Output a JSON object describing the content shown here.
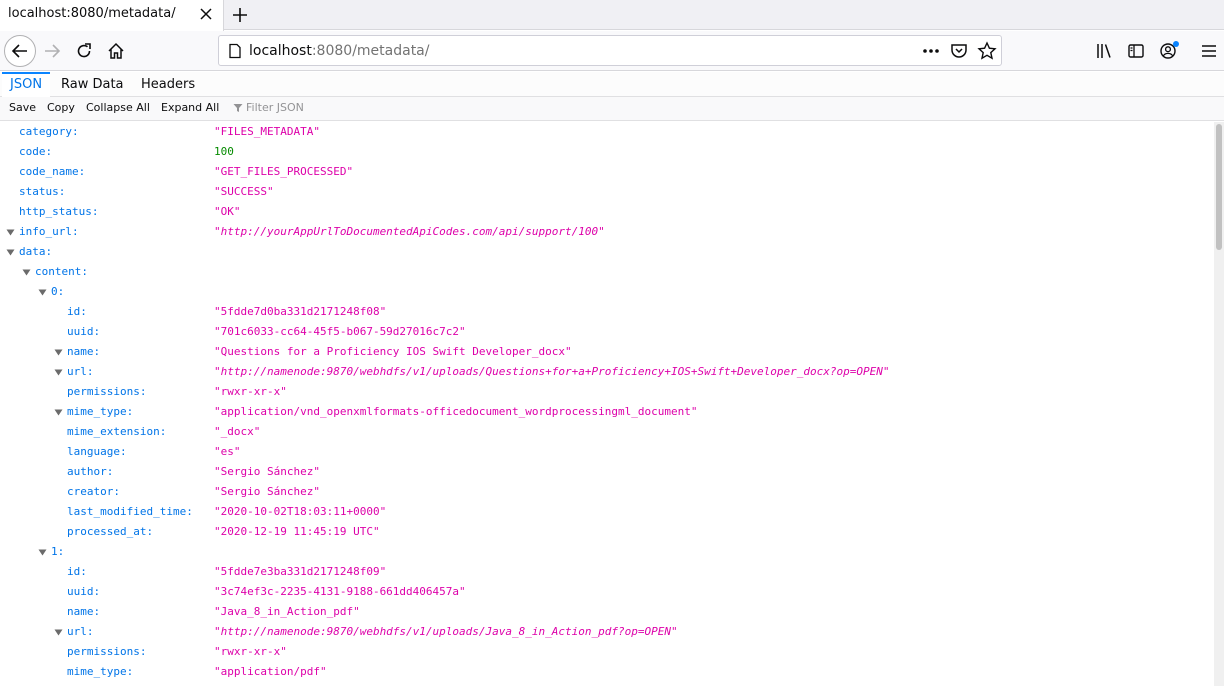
{
  "browser": {
    "tab_title": "localhost:8080/metadata/",
    "url_host": "localhost",
    "url_rest": ":8080/metadata/"
  },
  "viewer_tabs": [
    "JSON",
    "Raw Data",
    "Headers"
  ],
  "toolbar": {
    "save": "Save",
    "copy": "Copy",
    "collapse_all": "Collapse All",
    "expand_all": "Expand All",
    "filter_placeholder": "Filter JSON"
  },
  "rows": [
    {
      "k": "category:",
      "v": "\"FILES_METADATA\"",
      "t": "str",
      "d": 0,
      "x": false
    },
    {
      "k": "code:",
      "v": "100",
      "t": "num",
      "d": 0,
      "x": false
    },
    {
      "k": "code_name:",
      "v": "\"GET_FILES_PROCESSED\"",
      "t": "str",
      "d": 0,
      "x": false
    },
    {
      "k": "status:",
      "v": "\"SUCCESS\"",
      "t": "str",
      "d": 0,
      "x": false
    },
    {
      "k": "http_status:",
      "v": "\"OK\"",
      "t": "str",
      "d": 0,
      "x": false
    },
    {
      "k": "info_url:",
      "v": "\"http://yourAppUrlToDocumentedApiCodes.com/api/support/100\"",
      "t": "link",
      "d": 0,
      "x": true
    },
    {
      "k": "data:",
      "v": "",
      "t": "",
      "d": 0,
      "x": true
    },
    {
      "k": "content:",
      "v": "",
      "t": "",
      "d": 1,
      "x": true
    },
    {
      "k": "0:",
      "v": "",
      "t": "",
      "d": 2,
      "x": true
    },
    {
      "k": "id:",
      "v": "\"5fdde7d0ba331d2171248f08\"",
      "t": "str",
      "d": 3,
      "x": false
    },
    {
      "k": "uuid:",
      "v": "\"701c6033-cc64-45f5-b067-59d27016c7c2\"",
      "t": "str",
      "d": 3,
      "x": false
    },
    {
      "k": "name:",
      "v": "\"Questions for a Proficiency IOS Swift Developer_docx\"",
      "t": "str",
      "d": 3,
      "x": true
    },
    {
      "k": "url:",
      "v": "\"http://namenode:9870/webhdfs/v1/uploads/Questions+for+a+Proficiency+IOS+Swift+Developer_docx?op=OPEN\"",
      "t": "link",
      "d": 3,
      "x": true
    },
    {
      "k": "permissions:",
      "v": "\"rwxr-xr-x\"",
      "t": "str",
      "d": 3,
      "x": false
    },
    {
      "k": "mime_type:",
      "v": "\"application/vnd_openxmlformats-officedocument_wordprocessingml_document\"",
      "t": "str",
      "d": 3,
      "x": true
    },
    {
      "k": "mime_extension:",
      "v": "\"_docx\"",
      "t": "str",
      "d": 3,
      "x": false
    },
    {
      "k": "language:",
      "v": "\"es\"",
      "t": "str",
      "d": 3,
      "x": false
    },
    {
      "k": "author:",
      "v": "\"Sergio Sánchez\"",
      "t": "str",
      "d": 3,
      "x": false
    },
    {
      "k": "creator:",
      "v": "\"Sergio Sánchez\"",
      "t": "str",
      "d": 3,
      "x": false
    },
    {
      "k": "last_modified_time:",
      "v": "\"2020-10-02T18:03:11+0000\"",
      "t": "str",
      "d": 3,
      "x": false
    },
    {
      "k": "processed_at:",
      "v": "\"2020-12-19 11:45:19 UTC\"",
      "t": "str",
      "d": 3,
      "x": false
    },
    {
      "k": "1:",
      "v": "",
      "t": "",
      "d": 2,
      "x": true
    },
    {
      "k": "id:",
      "v": "\"5fdde7e3ba331d2171248f09\"",
      "t": "str",
      "d": 3,
      "x": false
    },
    {
      "k": "uuid:",
      "v": "\"3c74ef3c-2235-4131-9188-661dd406457a\"",
      "t": "str",
      "d": 3,
      "x": false
    },
    {
      "k": "name:",
      "v": "\"Java_8_in_Action_pdf\"",
      "t": "str",
      "d": 3,
      "x": false
    },
    {
      "k": "url:",
      "v": "\"http://namenode:9870/webhdfs/v1/uploads/Java_8_in_Action_pdf?op=OPEN\"",
      "t": "link",
      "d": 3,
      "x": true
    },
    {
      "k": "permissions:",
      "v": "\"rwxr-xr-x\"",
      "t": "str",
      "d": 3,
      "x": false
    },
    {
      "k": "mime_type:",
      "v": "\"application/pdf\"",
      "t": "str",
      "d": 3,
      "x": false
    }
  ]
}
